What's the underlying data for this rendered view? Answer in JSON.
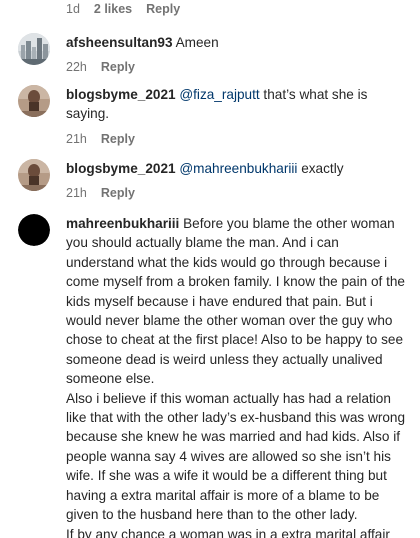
{
  "top_comment_meta": {
    "time": "1d",
    "likes": "2 likes",
    "reply": "Reply"
  },
  "comments": [
    {
      "username": "afsheensultan93",
      "mention": "",
      "text": "Ameen",
      "time": "22h",
      "reply": "Reply",
      "avatar_icon": "skyline-photo-avatar-icon"
    },
    {
      "username": "blogsbyme_2021",
      "mention": "@fiza_rajputt",
      "text": "that’s what she is saying.",
      "time": "21h",
      "reply": "Reply",
      "avatar_icon": "profile-photo-avatar-icon"
    },
    {
      "username": "blogsbyme_2021",
      "mention": "@mahreenbukhariii",
      "text": "exactly",
      "time": "21h",
      "reply": "Reply",
      "avatar_icon": "profile-photo-avatar-icon"
    },
    {
      "username": "mahreenbukhariii",
      "mention": "",
      "text": "Before you blame the other woman you should actually blame the man. And i can understand what the kids would go through because i come myself from a broken family. I know the pain of the kids myself because i have endured that pain. But i would never blame the other woman over the guy who chose to cheat at the first place! Also to be happy to see someone dead is weird unless they actually unalived someone else.\nAlso i believe if this woman actually has had a relation like that with the other lady’s ex-husband this was wrong because she knew he was married and had kids. Also if people wanna say 4 wives are allowed so she isn’t his wife. If she was a wife it would be a different thing but having a extra marital affair is more of a blame to be given to the husband here than to the other lady.\nIf by any chance a woman was in a extra marital affair",
      "time": "",
      "reply": "",
      "avatar_icon": "black-circle-avatar-icon"
    }
  ],
  "colors": {
    "text": "#262626",
    "meta": "#737373",
    "mention": "#00376b",
    "background": "#ffffff"
  }
}
